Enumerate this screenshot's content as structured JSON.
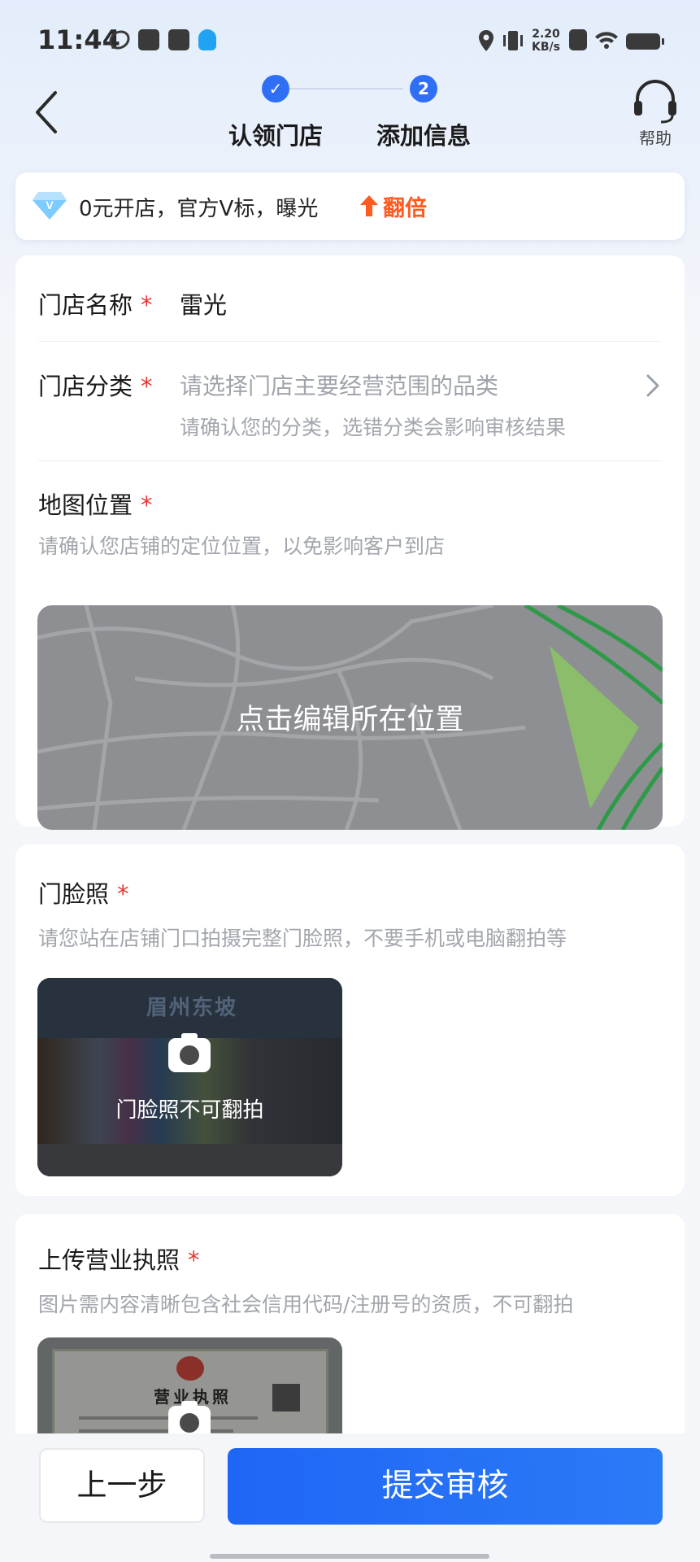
{
  "status_bar": {
    "time": "11:44",
    "net_speed_value": "2.20",
    "net_speed_unit": "KB/s"
  },
  "header": {
    "steps": [
      {
        "label": "认领门店",
        "state": "done",
        "marker": "✓"
      },
      {
        "label": "添加信息",
        "state": "current",
        "marker": "2"
      }
    ],
    "help_label": "帮助"
  },
  "promo": {
    "text": "0元开店，官方V标，曝光",
    "highlight": "翻倍",
    "highlight_color": "#ff5a1f"
  },
  "form": {
    "store_name": {
      "label": "门店名称",
      "required": "*",
      "value": "雷光"
    },
    "store_category": {
      "label": "门店分类",
      "required": "*",
      "placeholder": "请选择门店主要经营范围的品类",
      "hint": "请确认您的分类，选错分类会影响审核结果"
    },
    "map_location": {
      "label": "地图位置",
      "required": "*",
      "hint": "请确认您店铺的定位位置，以免影响客户到店",
      "map_overlay_text": "点击编辑所在位置"
    },
    "storefront_photo": {
      "label": "门脸照",
      "required": "*",
      "hint": "请您站在店铺门口拍摄完整门脸照，不要手机或电脑翻拍等",
      "caption": "门脸照不可翻拍",
      "sign_text": "眉州东坡"
    },
    "business_license": {
      "label": "上传营业执照",
      "required": "*",
      "hint": "图片需内容清晰包含社会信用代码/注册号的资质，不可翻拍",
      "sample_title": "营业执照"
    }
  },
  "bottom": {
    "prev_label": "上一步",
    "submit_label": "提交审核"
  },
  "colors": {
    "primary": "#2f6ff6",
    "required": "#e53935",
    "background": "#f4f6fa"
  }
}
